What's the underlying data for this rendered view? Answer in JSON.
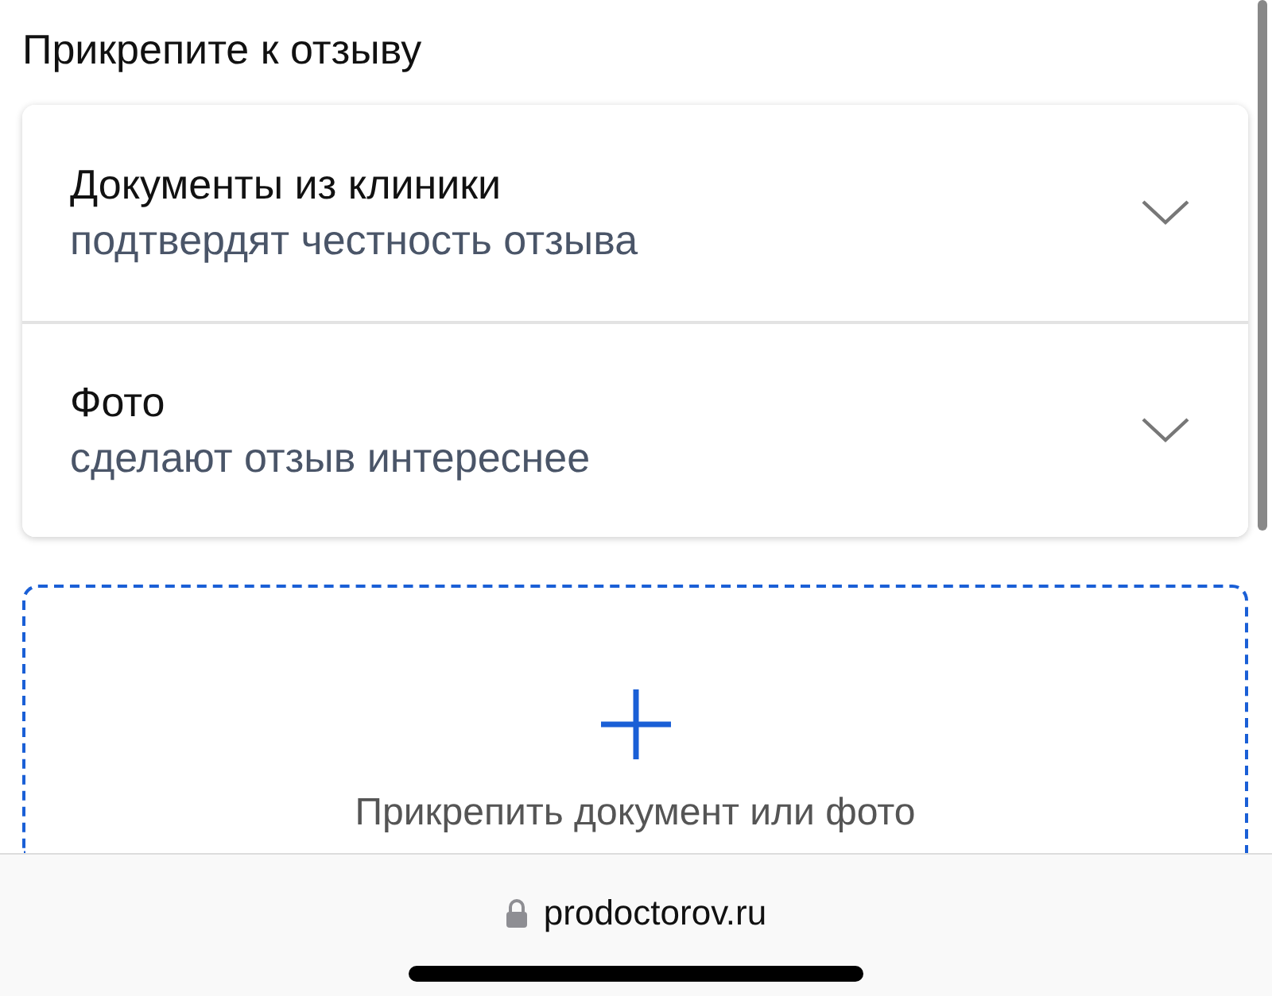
{
  "section_title": "Прикрепите к отзыву",
  "attachments": [
    {
      "title": "Документы из клиники",
      "subtitle": "подтвердят честность отзыва",
      "expanded": false
    },
    {
      "title": "Фото",
      "subtitle": "сделают отзыв интереснее",
      "expanded": false
    }
  ],
  "upload": {
    "label": "Прикрепить документ или фото"
  },
  "browser_bar": {
    "url": "prodoctorov.ru"
  }
}
